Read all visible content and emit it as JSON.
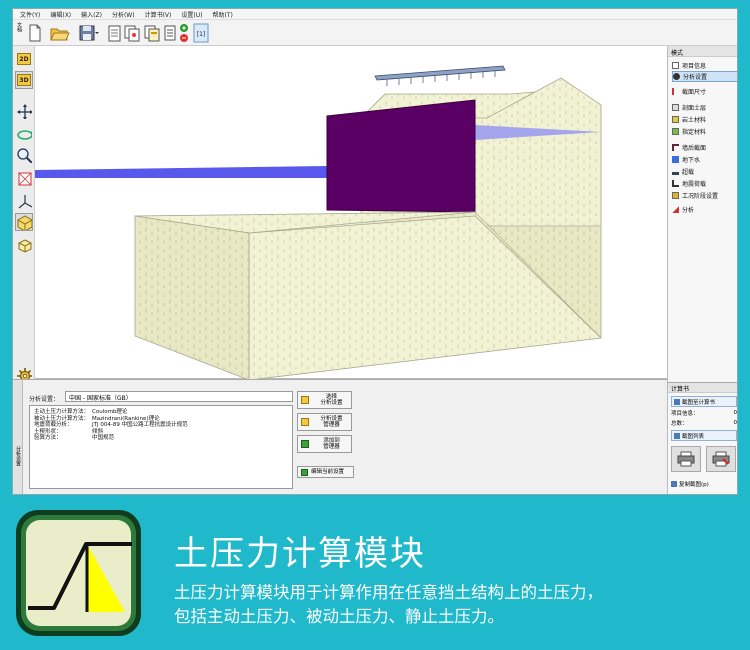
{
  "menu": [
    "文件(Y)",
    "编辑(X)",
    "输入(Z)",
    "分析(W)",
    "计算书(V)",
    "设置(U)",
    "帮助(T)"
  ],
  "toolbar": {
    "side_label": "文档",
    "mode_2d": "2D",
    "mode_3d": "3D"
  },
  "right_panel": {
    "title": "模式",
    "items": [
      "项目信息",
      "分析设置",
      "截面尺寸",
      "剖面土层",
      "岩土材料",
      "指定材料",
      "墙后截面",
      "地下水",
      "超载",
      "地震荷载",
      "工况阶段设置",
      "分析"
    ],
    "selected_index": 1
  },
  "bottom": {
    "side_tab": "分析设置",
    "setting_label": "分析设置：",
    "setting_value": "中国 - 国家标准（GB）",
    "rows": [
      {
        "k": "主动土压力计算方法：",
        "v": "Coulomb理论"
      },
      {
        "k": "被动土压力计算方法：",
        "v": "Mazindrani(Rankine)理论"
      },
      {
        "k": "地震荷载分析：",
        "v": "JTJ 004-89 中国公路工程抗震设计规范"
      },
      {
        "k": "土楔形状：",
        "v": "倾斜"
      },
      {
        "k": "验算方法：",
        "v": "中国规范"
      }
    ],
    "btn_select": [
      "选择",
      "分析设置"
    ],
    "btn_manager": [
      "分析设置",
      "管理器"
    ],
    "btn_add": [
      "添加到",
      "管理器"
    ],
    "btn_edit": "编辑当前设置"
  },
  "book": {
    "title": "计算书",
    "add_btn": "截图至计算书",
    "info_label": "项目信息：",
    "info_value": "0",
    "total_label": "总数：",
    "total_value": "0",
    "list_btn": "截图列表",
    "copy_btn": "复制截图(p)"
  },
  "caption": {
    "title": "土压力计算模块",
    "desc_line1": "土压力计算模块用于计算作用在任意挡土结构上的土压力，",
    "desc_line2": "包括主动土压力、被动土压力、静止土压力。"
  },
  "colors": {
    "background": "#1fb9cb",
    "wall": "#5a0064",
    "water": "#2a2ad8",
    "soil": "#f2f2d4",
    "logo_accent": "#ffff00"
  }
}
